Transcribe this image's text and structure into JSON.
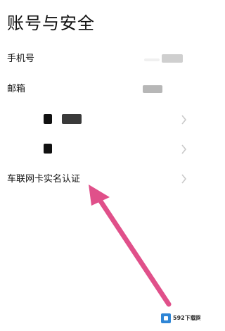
{
  "page": {
    "title": "账号与安全"
  },
  "rows": [
    {
      "label": "手机号",
      "value": ""
    },
    {
      "label": "邮箱",
      "value": ""
    },
    {
      "label": "",
      "value": ""
    },
    {
      "label": "",
      "value": ""
    },
    {
      "label": "车联网卡实名认证",
      "value": ""
    }
  ],
  "icons": {
    "chevron": "chevron-right-icon"
  },
  "colors": {
    "arrow": "#e0508a",
    "chevron": "#c9c9c9",
    "text": "#111111",
    "watermark_logo": "#2f86d6"
  },
  "watermark": {
    "text": "592下载网"
  }
}
